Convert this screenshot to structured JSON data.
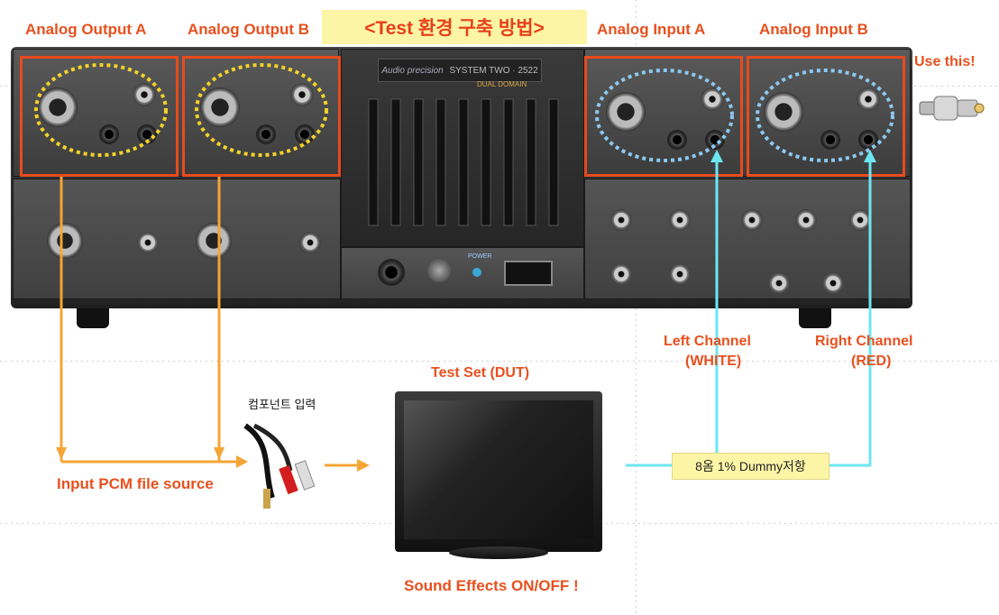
{
  "title": "<Test 환경 구축 방법>",
  "labels": {
    "analog_output_a": "Analog Output A",
    "analog_output_b": "Analog Output B",
    "analog_input_a": "Analog Input A",
    "analog_input_b": "Analog Input B",
    "use_this": "Use this!",
    "left_channel": "Left Channel",
    "left_channel_sub": "(WHITE)",
    "right_channel": "Right Channel",
    "right_channel_sub": "(RED)",
    "test_set": "Test Set (DUT)",
    "component_input": "컴포넌트 입력",
    "input_pcm": "Input PCM file source",
    "dummy_resistor": "8옴 1% Dummy저항",
    "sound_effects": "Sound Effects ON/OFF !"
  },
  "device": {
    "brand": "Audio precision",
    "model": "SYSTEM TWO · 2522",
    "sub": "DUAL DOMAIN",
    "power_label": "POWER"
  },
  "colors": {
    "orange_wire": "#f4a535",
    "cyan_wire": "#6de6f2",
    "label_orange": "#e8501e",
    "highlight_box": "#e84a1e",
    "title_bg": "#fdf5a6"
  }
}
